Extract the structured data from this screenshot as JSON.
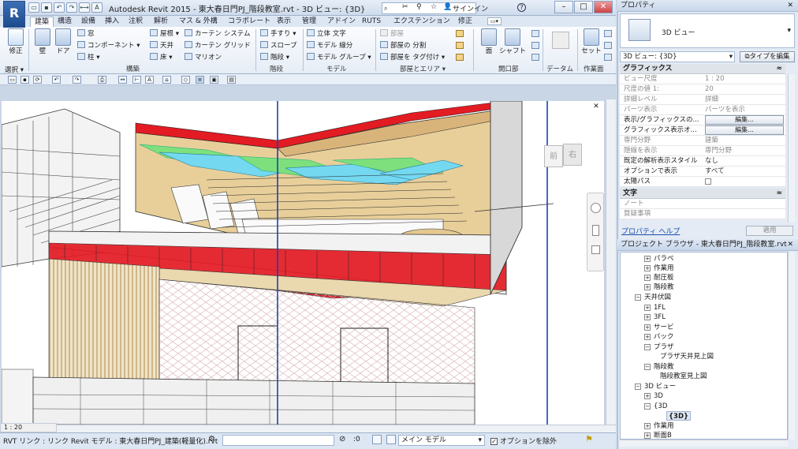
{
  "window": {
    "app_logo": "R",
    "title": "Autodesk Revit 2015 -   東大春日門PJ_階段教室.rvt - 3D ビュー: {3D}",
    "sign_in": "サインイン",
    "help": "?",
    "minimize": "–",
    "maximize": "□",
    "close": "✕"
  },
  "ribbon": {
    "tabs": [
      "建築",
      "構造",
      "設備",
      "挿入",
      "注釈",
      "解析",
      "マス & 外構",
      "コラボレート",
      "表示",
      "管理",
      "アドイン",
      "RUTS",
      "エクステンション",
      "修正"
    ],
    "modify": "修正",
    "select": "選択",
    "build": {
      "wall": "壁",
      "door": "ドア",
      "window": "窓",
      "component": "コンポーネント",
      "column": "柱",
      "roof": "屋根",
      "ceiling": "天井",
      "floor": "床",
      "curtain_system": "カーテン システム",
      "curtain_grid": "カーテン グリッド",
      "mullion": "マリオン",
      "label": "構築"
    },
    "circulation": {
      "railing": "手すり",
      "ramp": "スロープ",
      "stair": "階段",
      "label": "階段"
    },
    "model": {
      "text": "立体 文字",
      "line": "モデル 線分",
      "group": "モデル グループ",
      "label": "モデル"
    },
    "room": {
      "room": "部屋",
      "separator": "部屋の 分割",
      "tag": "部屋を タグ付け",
      "label": "部屋とエリア"
    },
    "opening": {
      "face": "面",
      "shaft": "シャフト",
      "label": "開口部"
    },
    "datum": {
      "label": "データム"
    },
    "workplane": {
      "set": "セット",
      "label": "作業面"
    }
  },
  "view": {
    "scale": "1 : 20",
    "viewcube_front": "前",
    "viewcube_right": "右"
  },
  "status": {
    "text": "RVT リンク : リンク Revit モデル : 東大春日門PJ_建築(軽量化).rvt",
    "selection_count": ":0",
    "model": "メイン モデル",
    "exclude_options": "オプションを除外"
  },
  "properties": {
    "title": "プロパティ",
    "type_name": "3D ビュー",
    "instance_selector": "3D ビュー: {3D}",
    "edit_type": "タイプを編集",
    "groups": {
      "graphics": "グラフィックス",
      "text": "文字"
    },
    "rows": [
      {
        "k": "ビュー尺度",
        "v": "1 : 20"
      },
      {
        "k": "尺度の値    1:",
        "v": "20"
      },
      {
        "k": "詳細レベル",
        "v": "詳細"
      },
      {
        "k": "パーツ表示",
        "v": "パーツを表示"
      },
      {
        "k": "表示/グラフィックスの...",
        "v": "編集..."
      },
      {
        "k": "グラフィックス表示オ...",
        "v": "編集..."
      },
      {
        "k": "専門分野",
        "v": "建築"
      },
      {
        "k": "隠線を表示",
        "v": "専門分野"
      },
      {
        "k": "既定の解析表示スタイル",
        "v": "なし"
      },
      {
        "k": "オプションで表示",
        "v": "すべて"
      },
      {
        "k": "太陽パス",
        "v": ""
      }
    ],
    "text_rows": [
      {
        "k": "ノート",
        "v": ""
      },
      {
        "k": "質疑事項",
        "v": ""
      }
    ],
    "help_link": "プロパティ ヘルプ",
    "apply": "適用"
  },
  "browser": {
    "title": "プロジェクト ブラウザ - 東大春日門PJ_階段教室.rvt",
    "items": [
      {
        "label": "パラペ",
        "ex": "+"
      },
      {
        "label": "作業用",
        "ex": "+"
      },
      {
        "label": "耐圧板",
        "ex": "+"
      },
      {
        "label": "階段教",
        "ex": "+"
      },
      {
        "label": "天井伏図",
        "ex": "−"
      },
      {
        "label": "1FL",
        "ex": "+"
      },
      {
        "label": "3FL",
        "ex": "+"
      },
      {
        "label": "サービ",
        "ex": "+"
      },
      {
        "label": "バック",
        "ex": "+"
      },
      {
        "label": "プラザ",
        "ex": "−"
      },
      {
        "label": "プラザ天井見上図",
        "ex": ""
      },
      {
        "label": "階段教",
        "ex": "−"
      },
      {
        "label": "階段教室見上図",
        "ex": ""
      },
      {
        "label": "3D ビュー",
        "ex": "−"
      },
      {
        "label": "3D",
        "ex": "+"
      },
      {
        "label": "{3D",
        "ex": "−"
      },
      {
        "label": "{3D}",
        "ex": ""
      },
      {
        "label": "作業用",
        "ex": "+"
      },
      {
        "label": "断面B",
        "ex": "+"
      }
    ]
  }
}
